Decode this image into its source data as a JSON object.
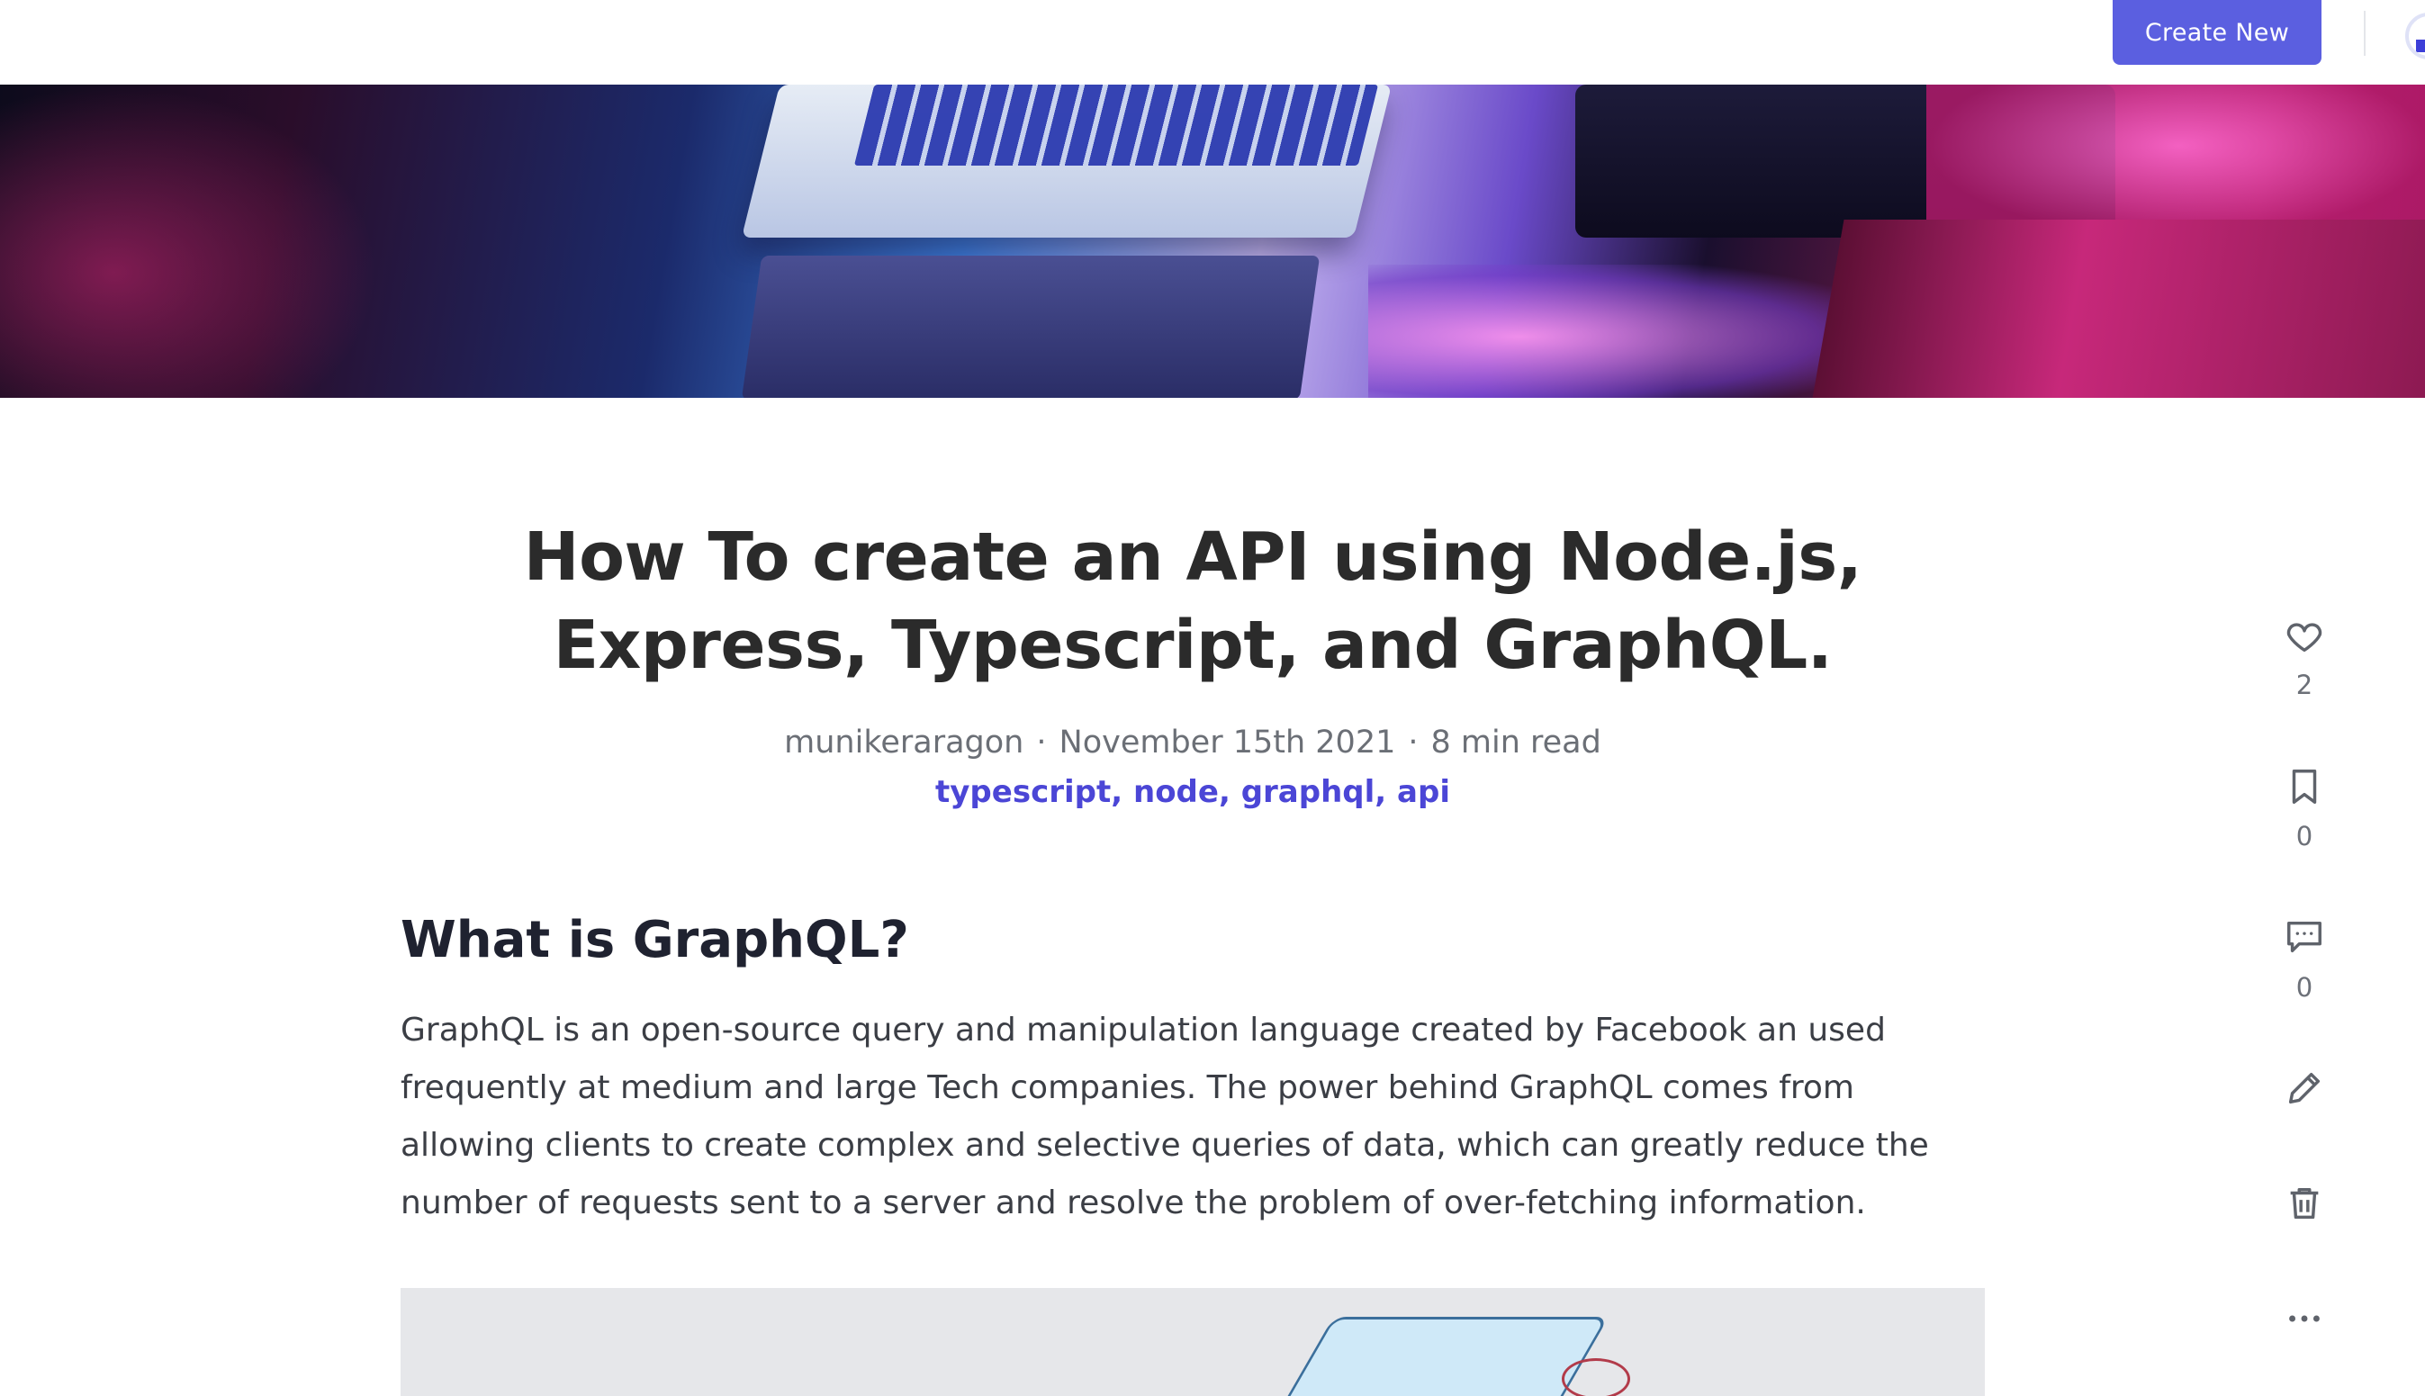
{
  "header": {
    "create_button_label": "Create New",
    "accent_color": "#5b5fe0"
  },
  "article": {
    "title": "How To create an API using Node.js, Express, Typescript, and GraphQL.",
    "author": "munikeraragon",
    "date": "November 15th 2021",
    "read_time": "8 min read",
    "meta_separator": "·",
    "tags_text": "typescript, node, graphql, api",
    "section_heading": "What is GraphQL?",
    "paragraph": "GraphQL is an open-source query and manipulation language created by Facebook an used frequently at medium and large Tech companies. The power behind GraphQL comes from allowing clients to create complex and selective queries of data, which can greatly reduce the number of requests sent to a server and resolve the problem of over-fetching information."
  },
  "actions": {
    "like": {
      "icon": "heart-icon",
      "count": "2"
    },
    "bookmark": {
      "icon": "bookmark-icon",
      "count": "0"
    },
    "comment": {
      "icon": "comment-icon",
      "count": "0"
    },
    "edit": {
      "icon": "pencil-icon"
    },
    "delete": {
      "icon": "trash-icon"
    },
    "more": {
      "icon": "more-dots-icon"
    }
  },
  "colors": {
    "tag_color": "#4b46d6",
    "title_color": "#2b2b2b",
    "meta_color": "#6b6f76"
  }
}
